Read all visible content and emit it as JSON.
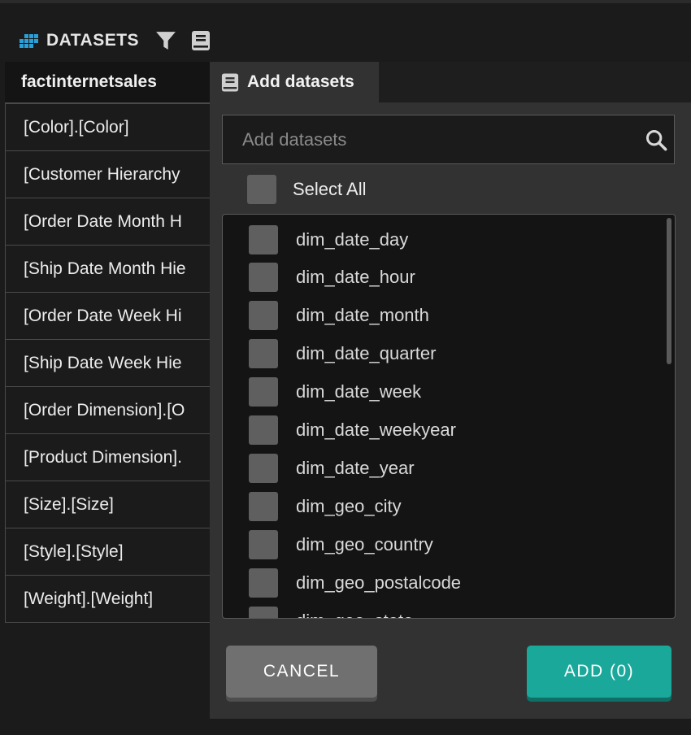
{
  "header": {
    "title": "DATASETS",
    "accent": "#2aa0d9"
  },
  "table": {
    "column": "factinternetsales",
    "rows": [
      "[Color].[Color]",
      "[Customer Hierarchy",
      "[Order Date Month H",
      "[Ship Date Month Hie",
      "[Order Date Week Hi",
      "[Ship Date Week Hie",
      "[Order Dimension].[O",
      "[Product Dimension].",
      "[Size].[Size]",
      "[Style].[Style]",
      "[Weight].[Weight]"
    ]
  },
  "popover": {
    "tab_label": "Add datasets",
    "search": {
      "placeholder": "Add datasets",
      "value": ""
    },
    "select_all_label": "Select All",
    "items": [
      "dim_date_day",
      "dim_date_hour",
      "dim_date_month",
      "dim_date_quarter",
      "dim_date_week",
      "dim_date_weekyear",
      "dim_date_year",
      "dim_geo_city",
      "dim_geo_country",
      "dim_geo_postalcode",
      "dim_geo_state"
    ],
    "cancel_label": "CANCEL",
    "add_label": "ADD (0)",
    "add_color": "#1aa89a"
  }
}
